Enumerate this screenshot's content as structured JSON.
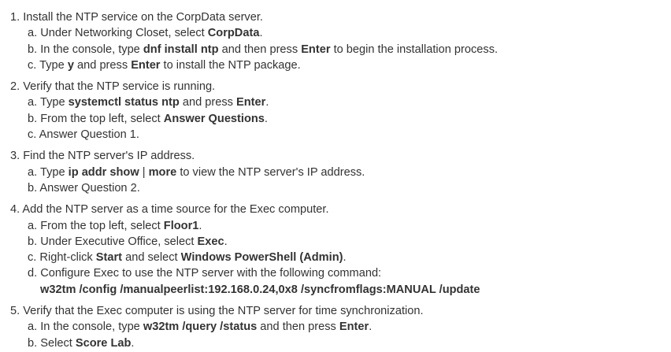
{
  "steps": [
    {
      "number": "1.",
      "title": "Install the NTP service on the CorpData server.",
      "substeps": [
        {
          "letter": "a.",
          "parts": [
            {
              "t": "Under Networking Closet, select "
            },
            {
              "t": "CorpData",
              "b": true
            },
            {
              "t": "."
            }
          ]
        },
        {
          "letter": "b.",
          "parts": [
            {
              "t": "In the console, type "
            },
            {
              "t": "dnf install ntp",
              "b": true
            },
            {
              "t": " and then press "
            },
            {
              "t": "Enter",
              "b": true
            },
            {
              "t": " to begin the installation process."
            }
          ]
        },
        {
          "letter": "c.",
          "parts": [
            {
              "t": "Type "
            },
            {
              "t": "y",
              "b": true
            },
            {
              "t": " and press "
            },
            {
              "t": "Enter",
              "b": true
            },
            {
              "t": " to install the NTP package."
            }
          ]
        }
      ]
    },
    {
      "number": "2.",
      "title": "Verify that the NTP service is running.",
      "substeps": [
        {
          "letter": "a.",
          "parts": [
            {
              "t": "Type "
            },
            {
              "t": "systemctl status ntp",
              "b": true
            },
            {
              "t": " and press "
            },
            {
              "t": "Enter",
              "b": true
            },
            {
              "t": "."
            }
          ]
        },
        {
          "letter": "b.",
          "parts": [
            {
              "t": "From the top left, select "
            },
            {
              "t": "Answer Questions",
              "b": true
            },
            {
              "t": "."
            }
          ]
        },
        {
          "letter": "c.",
          "parts": [
            {
              "t": "Answer Question 1."
            }
          ]
        }
      ]
    },
    {
      "number": "3.",
      "title": "Find the NTP server's IP address.",
      "substeps": [
        {
          "letter": "a.",
          "parts": [
            {
              "t": "Type "
            },
            {
              "t": "ip addr show",
              "b": true
            },
            {
              "t": " | "
            },
            {
              "t": "more",
              "b": true
            },
            {
              "t": " to view the NTP server's IP address."
            }
          ]
        },
        {
          "letter": "b.",
          "parts": [
            {
              "t": "Answer Question 2."
            }
          ]
        }
      ]
    },
    {
      "number": "4.",
      "title": "Add the NTP server as a time source for the Exec computer.",
      "substeps": [
        {
          "letter": "a.",
          "parts": [
            {
              "t": "From the top left, select "
            },
            {
              "t": "Floor1",
              "b": true
            },
            {
              "t": "."
            }
          ]
        },
        {
          "letter": "b.",
          "parts": [
            {
              "t": "Under Executive Office, select "
            },
            {
              "t": "Exec",
              "b": true
            },
            {
              "t": "."
            }
          ]
        },
        {
          "letter": "c.",
          "parts": [
            {
              "t": "Right-click "
            },
            {
              "t": "Start",
              "b": true
            },
            {
              "t": " and select "
            },
            {
              "t": "Windows PowerShell (Admin)",
              "b": true
            },
            {
              "t": "."
            }
          ]
        },
        {
          "letter": "d.",
          "parts": [
            {
              "t": "Configure Exec to use the NTP server with the following command:"
            }
          ],
          "command": "w32tm /config /manualpeerlist:192.168.0.24,0x8 /syncfromflags:MANUAL /update"
        }
      ]
    },
    {
      "number": "5.",
      "title": "Verify that the Exec computer is using the NTP server for time synchronization.",
      "substeps": [
        {
          "letter": "a.",
          "parts": [
            {
              "t": "In the console, type "
            },
            {
              "t": "w32tm /query /status",
              "b": true
            },
            {
              "t": " and then press "
            },
            {
              "t": "Enter",
              "b": true
            },
            {
              "t": "."
            }
          ]
        },
        {
          "letter": "b.",
          "parts": [
            {
              "t": "Select "
            },
            {
              "t": "Score Lab",
              "b": true
            },
            {
              "t": "."
            }
          ]
        }
      ]
    }
  ]
}
